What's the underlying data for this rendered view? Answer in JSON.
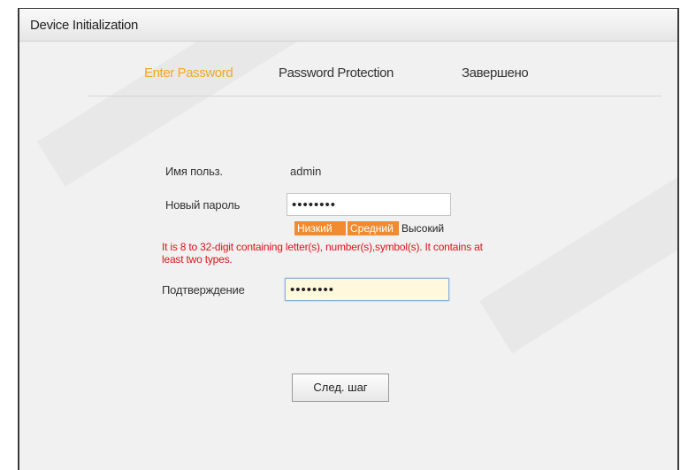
{
  "window": {
    "title": "Device Initialization"
  },
  "steps": [
    {
      "label": "Enter Password",
      "active": true
    },
    {
      "label": "Password Protection",
      "active": false
    },
    {
      "label": "Завершено",
      "active": false
    }
  ],
  "form": {
    "username_label": "Имя польз.",
    "username_value": "admin",
    "new_password_label": "Новый пароль",
    "new_password_value": "••••••••",
    "confirm_label": "Подтверждение",
    "confirm_value": "••••••••"
  },
  "strength": {
    "low": "Низкий",
    "medium": "Средний",
    "high": "Высокий",
    "level": "medium"
  },
  "warning": "It is 8 to 32-digit containing letter(s), number(s),symbol(s). It contains at least two types.",
  "buttons": {
    "next": "След. шаг"
  },
  "colors": {
    "active_step": "#f5a623",
    "strength_fill": "#f28b30",
    "warning": "#e8101a"
  }
}
